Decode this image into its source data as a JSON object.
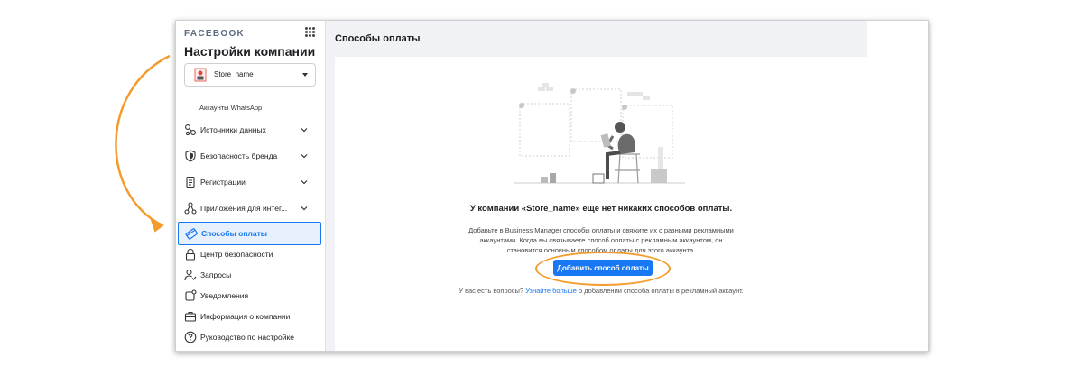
{
  "sidebar": {
    "brand": "FACEBOOK",
    "title": "Настройки компании",
    "account": {
      "name": "Store_name"
    },
    "whatsapp_label": "Аккаунты WhatsApp",
    "items": [
      {
        "label": "Источники данных",
        "icon": "data-sources-icon",
        "expandable": true
      },
      {
        "label": "Безопасность бренда",
        "icon": "shield-icon",
        "expandable": true
      },
      {
        "label": "Регистрации",
        "icon": "registrations-icon",
        "expandable": true
      },
      {
        "label": "Приложения для интег...",
        "icon": "integrations-icon",
        "expandable": true
      },
      {
        "label": "Способы оплаты",
        "icon": "credit-card-icon",
        "active": true
      },
      {
        "label": "Центр безопасности",
        "icon": "lock-icon"
      },
      {
        "label": "Запросы",
        "icon": "requests-icon"
      },
      {
        "label": "Уведомления",
        "icon": "notifications-icon"
      },
      {
        "label": "Информация о компании",
        "icon": "briefcase-icon"
      },
      {
        "label": "Руководство по настройке",
        "icon": "help-icon"
      }
    ]
  },
  "main": {
    "title": "Способы оплаты",
    "empty_title": "У компании «Store_name» еще нет никаких способов оплаты.",
    "empty_desc": "Добавьте в Business Manager способы оплаты и свяжите их с разными рекламными аккаунтами. Когда вы связываете способ оплаты с рекламным аккаунтом, он становится основным способом оплаты для этого аккаунта.",
    "add_button": "Добавить способ оплаты",
    "help_prefix": "У вас есть вопросы?",
    "help_link": "Узнайте больше",
    "help_suffix": "о добавлении способа оплаты в рекламный аккаунт."
  },
  "colors": {
    "accent": "#1877f2",
    "annotation": "#f39c2d"
  }
}
